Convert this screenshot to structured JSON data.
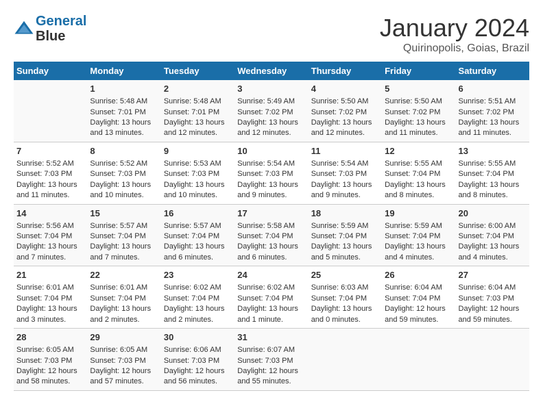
{
  "header": {
    "logo_line1": "General",
    "logo_line2": "Blue",
    "month": "January 2024",
    "location": "Quirinopolis, Goias, Brazil"
  },
  "weekdays": [
    "Sunday",
    "Monday",
    "Tuesday",
    "Wednesday",
    "Thursday",
    "Friday",
    "Saturday"
  ],
  "weeks": [
    [
      {
        "day": "",
        "info": ""
      },
      {
        "day": "1",
        "info": "Sunrise: 5:48 AM\nSunset: 7:01 PM\nDaylight: 13 hours\nand 13 minutes."
      },
      {
        "day": "2",
        "info": "Sunrise: 5:48 AM\nSunset: 7:01 PM\nDaylight: 13 hours\nand 12 minutes."
      },
      {
        "day": "3",
        "info": "Sunrise: 5:49 AM\nSunset: 7:02 PM\nDaylight: 13 hours\nand 12 minutes."
      },
      {
        "day": "4",
        "info": "Sunrise: 5:50 AM\nSunset: 7:02 PM\nDaylight: 13 hours\nand 12 minutes."
      },
      {
        "day": "5",
        "info": "Sunrise: 5:50 AM\nSunset: 7:02 PM\nDaylight: 13 hours\nand 11 minutes."
      },
      {
        "day": "6",
        "info": "Sunrise: 5:51 AM\nSunset: 7:02 PM\nDaylight: 13 hours\nand 11 minutes."
      }
    ],
    [
      {
        "day": "7",
        "info": "Sunrise: 5:52 AM\nSunset: 7:03 PM\nDaylight: 13 hours\nand 11 minutes."
      },
      {
        "day": "8",
        "info": "Sunrise: 5:52 AM\nSunset: 7:03 PM\nDaylight: 13 hours\nand 10 minutes."
      },
      {
        "day": "9",
        "info": "Sunrise: 5:53 AM\nSunset: 7:03 PM\nDaylight: 13 hours\nand 10 minutes."
      },
      {
        "day": "10",
        "info": "Sunrise: 5:54 AM\nSunset: 7:03 PM\nDaylight: 13 hours\nand 9 minutes."
      },
      {
        "day": "11",
        "info": "Sunrise: 5:54 AM\nSunset: 7:03 PM\nDaylight: 13 hours\nand 9 minutes."
      },
      {
        "day": "12",
        "info": "Sunrise: 5:55 AM\nSunset: 7:04 PM\nDaylight: 13 hours\nand 8 minutes."
      },
      {
        "day": "13",
        "info": "Sunrise: 5:55 AM\nSunset: 7:04 PM\nDaylight: 13 hours\nand 8 minutes."
      }
    ],
    [
      {
        "day": "14",
        "info": "Sunrise: 5:56 AM\nSunset: 7:04 PM\nDaylight: 13 hours\nand 7 minutes."
      },
      {
        "day": "15",
        "info": "Sunrise: 5:57 AM\nSunset: 7:04 PM\nDaylight: 13 hours\nand 7 minutes."
      },
      {
        "day": "16",
        "info": "Sunrise: 5:57 AM\nSunset: 7:04 PM\nDaylight: 13 hours\nand 6 minutes."
      },
      {
        "day": "17",
        "info": "Sunrise: 5:58 AM\nSunset: 7:04 PM\nDaylight: 13 hours\nand 6 minutes."
      },
      {
        "day": "18",
        "info": "Sunrise: 5:59 AM\nSunset: 7:04 PM\nDaylight: 13 hours\nand 5 minutes."
      },
      {
        "day": "19",
        "info": "Sunrise: 5:59 AM\nSunset: 7:04 PM\nDaylight: 13 hours\nand 4 minutes."
      },
      {
        "day": "20",
        "info": "Sunrise: 6:00 AM\nSunset: 7:04 PM\nDaylight: 13 hours\nand 4 minutes."
      }
    ],
    [
      {
        "day": "21",
        "info": "Sunrise: 6:01 AM\nSunset: 7:04 PM\nDaylight: 13 hours\nand 3 minutes."
      },
      {
        "day": "22",
        "info": "Sunrise: 6:01 AM\nSunset: 7:04 PM\nDaylight: 13 hours\nand 2 minutes."
      },
      {
        "day": "23",
        "info": "Sunrise: 6:02 AM\nSunset: 7:04 PM\nDaylight: 13 hours\nand 2 minutes."
      },
      {
        "day": "24",
        "info": "Sunrise: 6:02 AM\nSunset: 7:04 PM\nDaylight: 13 hours\nand 1 minute."
      },
      {
        "day": "25",
        "info": "Sunrise: 6:03 AM\nSunset: 7:04 PM\nDaylight: 13 hours\nand 0 minutes."
      },
      {
        "day": "26",
        "info": "Sunrise: 6:04 AM\nSunset: 7:04 PM\nDaylight: 12 hours\nand 59 minutes."
      },
      {
        "day": "27",
        "info": "Sunrise: 6:04 AM\nSunset: 7:03 PM\nDaylight: 12 hours\nand 59 minutes."
      }
    ],
    [
      {
        "day": "28",
        "info": "Sunrise: 6:05 AM\nSunset: 7:03 PM\nDaylight: 12 hours\nand 58 minutes."
      },
      {
        "day": "29",
        "info": "Sunrise: 6:05 AM\nSunset: 7:03 PM\nDaylight: 12 hours\nand 57 minutes."
      },
      {
        "day": "30",
        "info": "Sunrise: 6:06 AM\nSunset: 7:03 PM\nDaylight: 12 hours\nand 56 minutes."
      },
      {
        "day": "31",
        "info": "Sunrise: 6:07 AM\nSunset: 7:03 PM\nDaylight: 12 hours\nand 55 minutes."
      },
      {
        "day": "",
        "info": ""
      },
      {
        "day": "",
        "info": ""
      },
      {
        "day": "",
        "info": ""
      }
    ]
  ]
}
